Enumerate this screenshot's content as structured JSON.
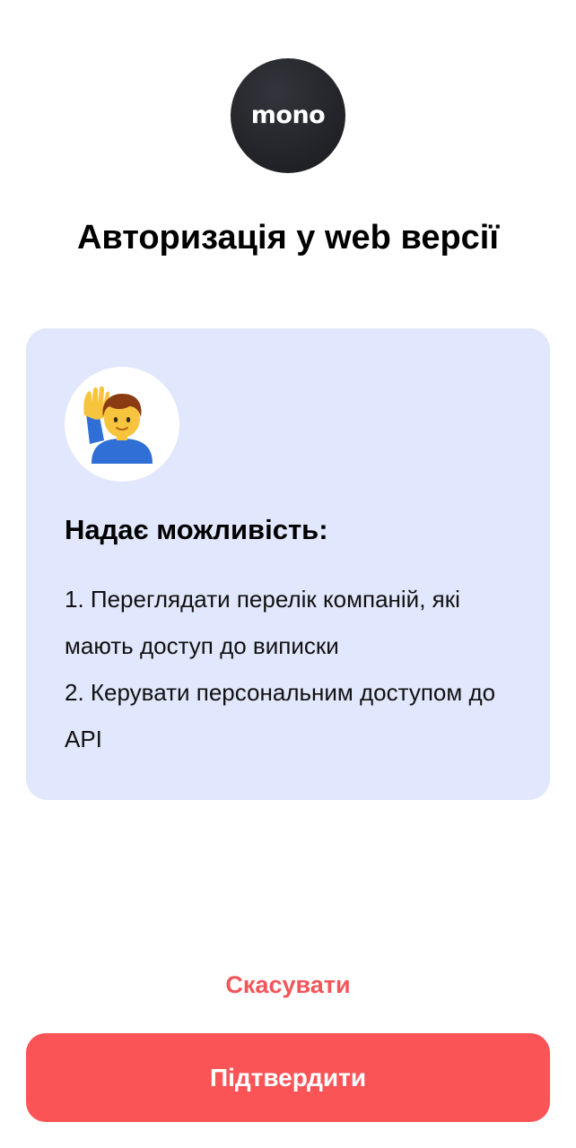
{
  "logo": {
    "text": "mono"
  },
  "title": "Авторизація у web версії",
  "card": {
    "icon": "person-raising-hand-emoji",
    "heading": "Надає можливість:",
    "items": [
      "1. Переглядати перелік компаній, які мають доступ до виписки",
      "2. Керувати персональним доступом до API"
    ]
  },
  "actions": {
    "cancel_label": "Скасувати",
    "confirm_label": "Підтвердити"
  },
  "colors": {
    "accent": "#fa5457",
    "card_background": "#e1e7fc",
    "logo_background": "#202227"
  }
}
